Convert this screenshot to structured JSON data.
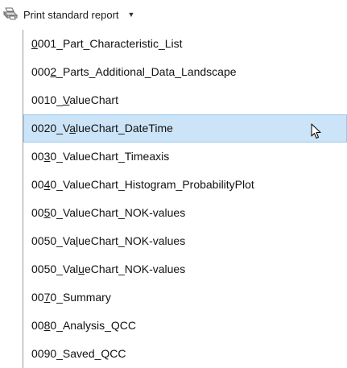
{
  "toolbar": {
    "print_label": "Print standard report",
    "print_icon": "printer-icon",
    "dropdown_icon": "caret-down-icon"
  },
  "menu": {
    "highlighted_index": 3,
    "items": [
      {
        "before": "",
        "mnemonic": "0",
        "after": "001_Part_Characteristic_List"
      },
      {
        "before": "000",
        "mnemonic": "2",
        "after": "_Parts_Additional_Data_Landscape"
      },
      {
        "before": "0010_",
        "mnemonic": "V",
        "after": "alueChart"
      },
      {
        "before": "0020_V",
        "mnemonic": "a",
        "after": "lueChart_DateTime"
      },
      {
        "before": "00",
        "mnemonic": "3",
        "after": "0_ValueChart_Timeaxis"
      },
      {
        "before": "00",
        "mnemonic": "4",
        "after": "0_ValueChart_Histogram_ProbabilityPlot"
      },
      {
        "before": "00",
        "mnemonic": "5",
        "after": "0_ValueChart_NOK-values"
      },
      {
        "before": "0050_Va",
        "mnemonic": "l",
        "after": "ueChart_NOK-values"
      },
      {
        "before": "0050_Val",
        "mnemonic": "u",
        "after": "eChart_NOK-values"
      },
      {
        "before": "00",
        "mnemonic": "7",
        "after": "0_Summary"
      },
      {
        "before": "00",
        "mnemonic": "8",
        "after": "0_Analysis_QCC"
      },
      {
        "before": "0090_Saved_QCC",
        "mnemonic": "",
        "after": ""
      }
    ]
  },
  "colors": {
    "highlight_bg": "#cce4f7",
    "highlight_border": "#99c9ef"
  }
}
